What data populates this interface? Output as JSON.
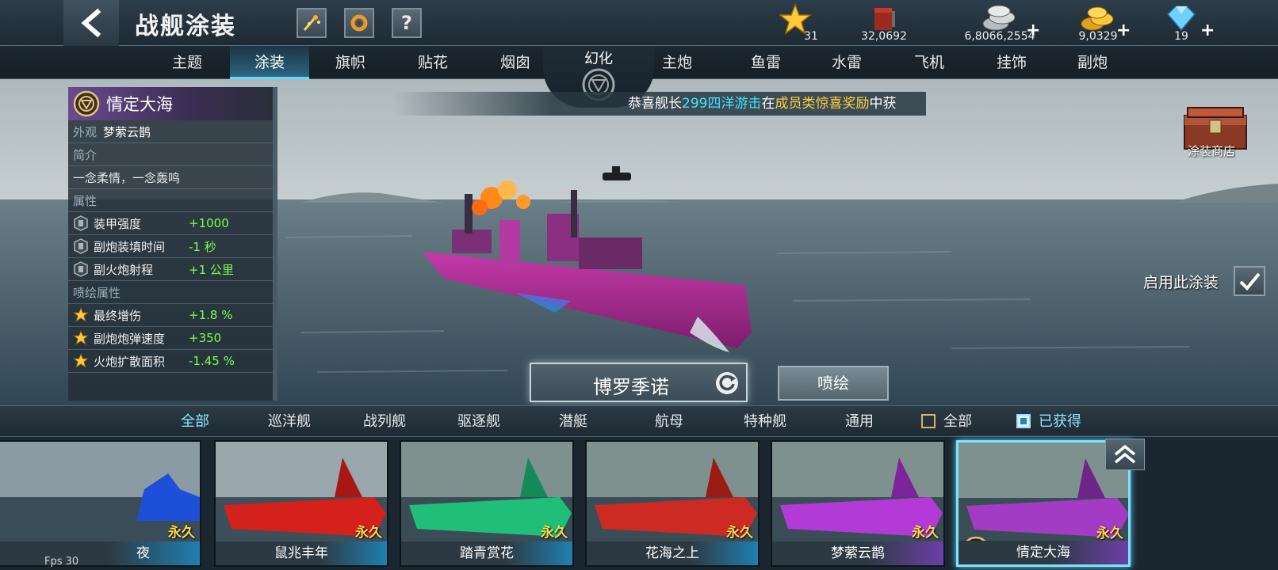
{
  "header": {
    "title": "战舰涂装",
    "help_label": "?"
  },
  "resources": [
    {
      "name": "star-icon",
      "value": "31"
    },
    {
      "name": "paint-bucket-icon",
      "value": "32,0692"
    },
    {
      "name": "silver-coins-icon",
      "value": "6,8066,2554",
      "plus": "+"
    },
    {
      "name": "gold-coins-icon",
      "value": "9,0329",
      "plus": "+"
    },
    {
      "name": "diamond-icon",
      "value": "19",
      "plus": "+"
    }
  ],
  "tabs": {
    "left": [
      "主题",
      "涂装",
      "旗帜",
      "贴花",
      "烟囱"
    ],
    "center": "幻化",
    "right": [
      "主炮",
      "鱼雷",
      "水雷",
      "飞机",
      "挂饰",
      "副炮"
    ],
    "active": "涂装"
  },
  "info_panel": {
    "skin_name": "情定大海",
    "appearance_key": "外观",
    "appearance_value": "梦萦云鹊",
    "intro_header": "简介",
    "intro_text": "一念柔情，一念轰鸣",
    "attr_header": "属性",
    "attributes": [
      {
        "name": "装甲强度",
        "value": "+1000"
      },
      {
        "name": "副炮装填时间",
        "value": "-1 秒"
      },
      {
        "name": "副火炮射程",
        "value": "+1 公里"
      }
    ],
    "spray_header": "喷绘属性",
    "spray_attributes": [
      {
        "name": "最终增伤",
        "value": "+1.8 %"
      },
      {
        "name": "副炮炮弹速度",
        "value": "+350"
      },
      {
        "name": "火炮扩散面积",
        "value": "-1.45 %"
      }
    ]
  },
  "marquee": {
    "part1": "恭喜舰长",
    "part2": "299四洋游击",
    "part3": "在",
    "part4": "成员类惊喜奖励",
    "part5": "中获"
  },
  "shop": {
    "label": "涂装商店"
  },
  "apply": {
    "label": "启用此涂装",
    "checked": true
  },
  "ship": {
    "name": "博罗季诺"
  },
  "spray_button": "喷绘",
  "filter": {
    "categories": [
      "全部",
      "巡洋舰",
      "战列舰",
      "驱逐舰",
      "潜艇",
      "航母",
      "特种舰",
      "通用"
    ],
    "active": "全部",
    "check_all": "全部",
    "check_owned": "已获得"
  },
  "cards": [
    {
      "name": "夜",
      "tag": "永久",
      "color": "#1d4fd8"
    },
    {
      "name": "鼠兆丰年",
      "tag": "永久",
      "color": "#d4211c"
    },
    {
      "name": "踏青赏花",
      "tag": "永久",
      "color": "#1fbf7a"
    },
    {
      "name": "花海之上",
      "tag": "永久",
      "color": "#cc2a22"
    },
    {
      "name": "梦萦云鹊",
      "tag": "永久",
      "color": "#b33ad6"
    },
    {
      "name": "情定大海",
      "tag": "永久",
      "color": "#a43bc4"
    }
  ],
  "fps": "Fps 30"
}
